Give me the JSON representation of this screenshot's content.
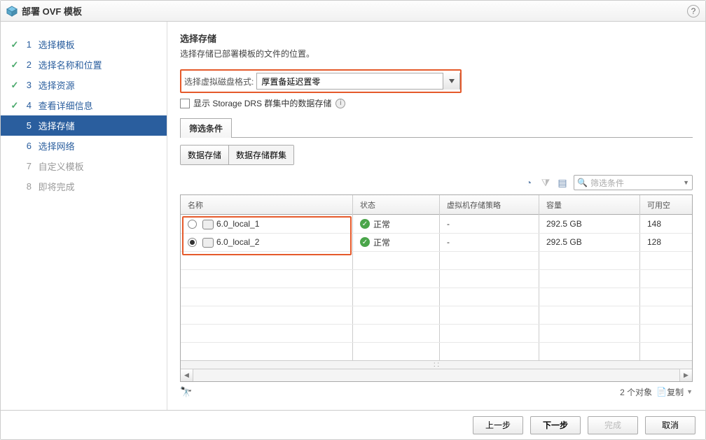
{
  "dialog": {
    "title": "部署 OVF 模板"
  },
  "sidebar": {
    "steps": [
      {
        "num": "1",
        "label": "选择模板"
      },
      {
        "num": "2",
        "label": "选择名称和位置"
      },
      {
        "num": "3",
        "label": "选择资源"
      },
      {
        "num": "4",
        "label": "查看详细信息"
      },
      {
        "num": "5",
        "label": "选择存储"
      },
      {
        "num": "6",
        "label": "选择网络"
      },
      {
        "num": "7",
        "label": "自定义模板"
      },
      {
        "num": "8",
        "label": "即将完成"
      }
    ]
  },
  "content": {
    "title": "选择存储",
    "subtitle": "选择存储已部署模板的文件的位置。",
    "format_label": "选择虚拟磁盘格式:",
    "format_value": "厚置备延迟置零",
    "drs_checkbox": "显示 Storage DRS 群集中的数据存储",
    "tab_label": "筛选条件",
    "subtab_a": "数据存储",
    "subtab_b": "数据存储群集",
    "filter_placeholder": "筛选条件"
  },
  "table": {
    "headers": {
      "name": "名称",
      "status": "状态",
      "policy": "虚拟机存储策略",
      "capacity": "容量",
      "free": "可用空"
    },
    "rows": [
      {
        "name": "6.0_local_1",
        "status": "正常",
        "policy": "-",
        "capacity": "292.5 GB",
        "free": "148",
        "selected": false
      },
      {
        "name": "6.0_local_2",
        "status": "正常",
        "policy": "-",
        "capacity": "292.5 GB",
        "free": "128",
        "selected": true
      }
    ],
    "footer_count": "2 个对象",
    "footer_copy": "复制"
  },
  "footer": {
    "back": "上一步",
    "next": "下一步",
    "finish": "完成",
    "cancel": "取消"
  }
}
